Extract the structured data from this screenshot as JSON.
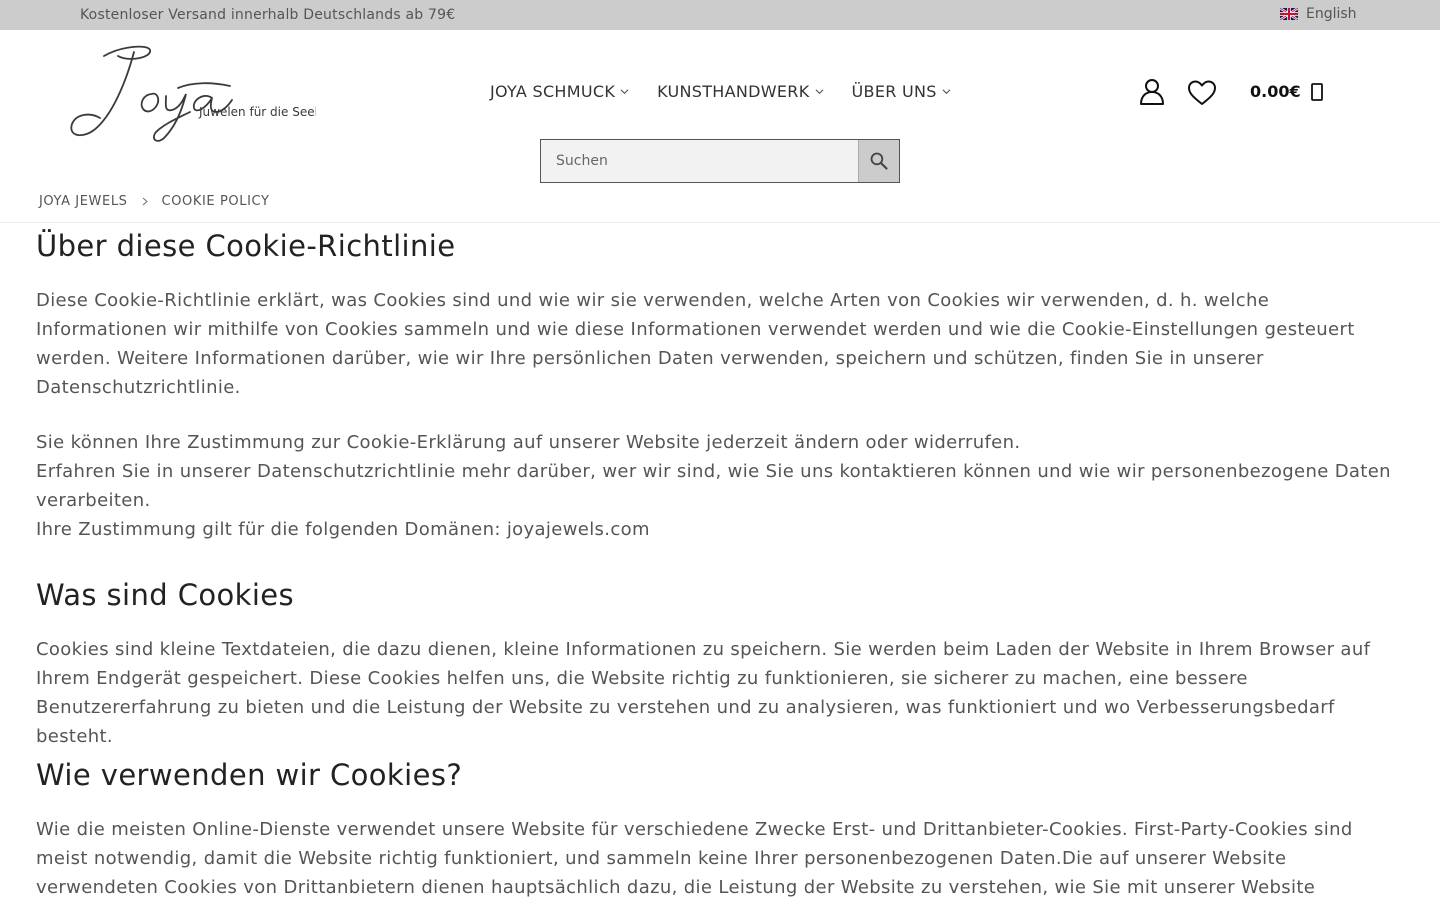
{
  "topbar": {
    "shipping_message": "Kostenloser Versand innerhalb Deutschlands ab 79€",
    "language": "English"
  },
  "header": {
    "logo": {
      "brand": "Joya",
      "tagline": "Juwelen für die Seele"
    },
    "nav": [
      {
        "label": "JOYA SCHMUCK"
      },
      {
        "label": "KUNSTHANDWERK"
      },
      {
        "label": "ÜBER UNS"
      }
    ],
    "cart_total": "0.00€",
    "search": {
      "placeholder": "Suchen"
    },
    "icons": {
      "account": "user-icon",
      "wishlist": "heart-icon",
      "cart": "shopping-bag-icon",
      "search": "search-icon",
      "language": "uk-flag-icon",
      "dropdown": "chevron-down-icon"
    }
  },
  "breadcrumb": {
    "home": "JOYA JEWELS",
    "current": "COOKIE POLICY"
  },
  "content": {
    "sections": [
      {
        "heading": "Über diese Cookie-Richtlinie",
        "paragraphs": [
          "Diese Cookie-Richtlinie erklärt, was Cookies sind und wie wir sie verwenden, welche Arten von Cookies wir verwenden, d. h. welche Informationen wir mithilfe von Cookies sammeln und wie diese Informationen verwendet werden und wie die Cookie-Einstellungen gesteuert werden. Weitere Informationen darüber, wie wir Ihre persönlichen Daten verwenden, speichern und schützen, finden Sie in unserer Datenschutzrichtlinie.",
          "Sie können Ihre Zustimmung zur Cookie-Erklärung auf unserer Website jederzeit ändern oder widerrufen.",
          "Erfahren Sie in unserer Datenschutzrichtlinie mehr darüber, wer wir sind, wie Sie uns kontaktieren können und wie wir personenbezogene Daten verarbeiten.",
          "Ihre Zustimmung gilt für die folgenden Domänen: joyajewels.com"
        ]
      },
      {
        "heading": "Was sind Cookies",
        "paragraphs": [
          "Cookies sind kleine Textdateien, die dazu dienen, kleine Informationen zu speichern. Sie werden beim Laden der Website in Ihrem Browser auf Ihrem Endgerät gespeichert. Diese Cookies helfen uns, die Website richtig zu funktionieren, sie sicherer zu machen, eine bessere Benutzererfahrung zu bieten und die Leistung der Website zu verstehen und zu analysieren, was funktioniert und wo Verbesserungsbedarf besteht."
        ]
      },
      {
        "heading": "Wie verwenden wir Cookies?",
        "paragraphs": [
          "Wie die meisten Online-Dienste verwendet unsere Website für verschiedene Zwecke Erst- und Drittanbieter-Cookies. First-Party-Cookies sind meist notwendig, damit die Website richtig funktioniert, und sammeln keine Ihrer personenbezogenen Daten.Die auf unserer Website verwendeten Cookies von Drittanbietern dienen hauptsächlich dazu, die Leistung der Website zu verstehen, wie Sie mit unserer Website"
        ]
      }
    ]
  },
  "colors": {
    "topbar_bg": "#cccccc",
    "text": "#555555",
    "heading": "#222222",
    "search_bg": "#f2f2f2",
    "search_button_bg": "#cccccc"
  }
}
